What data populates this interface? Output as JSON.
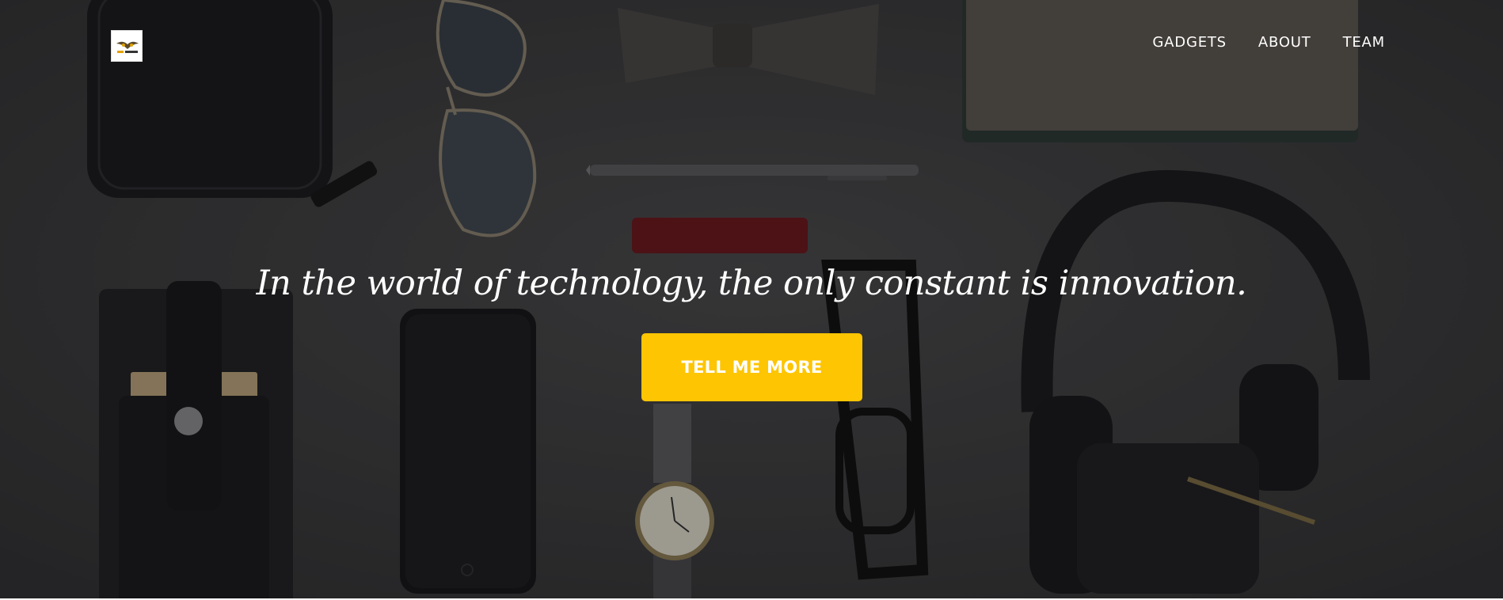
{
  "site": {
    "logo_icon": "owl-logo-icon",
    "logo_text": "Tech Trends"
  },
  "nav": {
    "items": [
      {
        "label": "GADGETS"
      },
      {
        "label": "ABOUT"
      },
      {
        "label": "TEAM"
      }
    ]
  },
  "hero": {
    "headline": "In the world of technology, the only constant is innovation.",
    "cta_label": "TELL ME MORE",
    "background_image": "flat-lay of gadgets: wallet, sunglasses, bow tie, pen, notebook, phone case, phone, watch, glasses, headphones"
  },
  "colors": {
    "accent": "#fec503",
    "overlay": "#3b3b3d",
    "text": "#ffffff"
  }
}
